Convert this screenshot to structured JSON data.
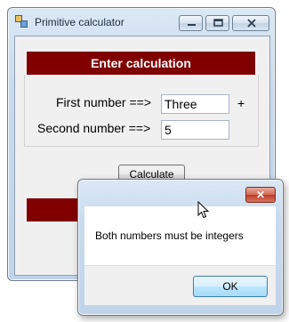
{
  "main_window": {
    "title": "Primitive calculator",
    "header": "Enter calculation",
    "first_label": "First number ==>",
    "first_value": "Three",
    "operator": "+",
    "second_label": "Second number ==>",
    "second_value": "5",
    "calculate_label": "Calculate",
    "accent_color": "#800000"
  },
  "message_box": {
    "close_glyph": "✕",
    "message": "Both numbers must be integers",
    "ok_label": "OK"
  }
}
